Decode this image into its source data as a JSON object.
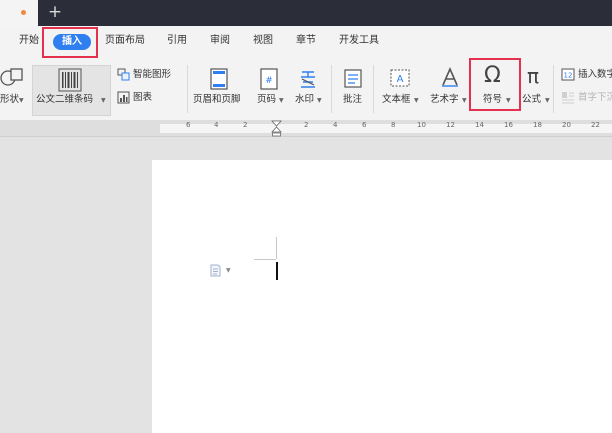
{
  "titlebar": {
    "new_tab_symbol": "+"
  },
  "menu": {
    "start": "开始",
    "insert": "插入",
    "layout": "页面布局",
    "reference": "引用",
    "review": "审阅",
    "view": "视图",
    "chapter": "章节",
    "developer": "开发工具"
  },
  "ribbon": {
    "shape": "形状",
    "qr_code": "公文二维条码",
    "smart_graphic": "智能图形",
    "chart": "图表",
    "header_footer": "页眉和页脚",
    "page_number": "页码",
    "watermark": "水印",
    "annotation": "批注",
    "textbox": "文本框",
    "wordart": "艺术字",
    "symbol": "符号",
    "formula": "公式",
    "insert_number": "插入数字",
    "drop_cap": "首字下沉",
    "symbol_glyph": "Ω",
    "formula_glyph": "π"
  },
  "ruler": {
    "labels": [
      "6",
      "4",
      "2",
      "2",
      "4",
      "6",
      "8",
      "10",
      "12",
      "14",
      "16",
      "18",
      "20",
      "22"
    ]
  },
  "colors": {
    "accent": "#2f7ff0",
    "highlight": "#e6304f",
    "titlebar": "#2b2d39"
  }
}
